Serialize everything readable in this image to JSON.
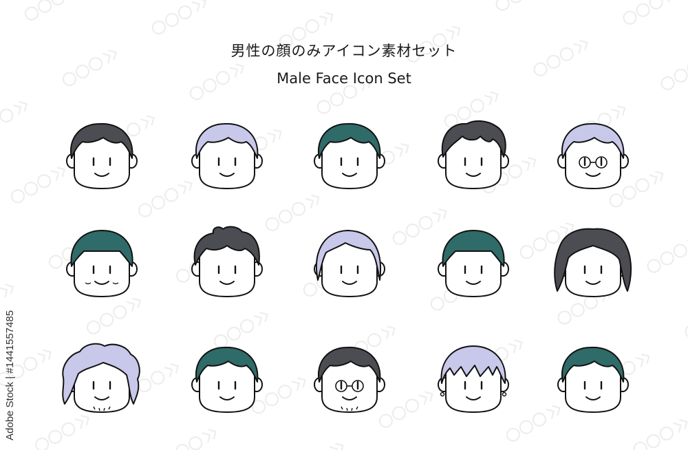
{
  "title_jp": "男性の顔のみアイコン素材セット",
  "title_en": "Male Face Icon Set",
  "watermark_side": "Adobe Stock | #1441557485",
  "colors": {
    "outline": "#111111",
    "dark_hair": "#4b4d52",
    "teal_hair": "#2f6b68",
    "lavender_hair": "#c8c8ea",
    "skin": "#ffffff"
  },
  "faces": [
    {
      "hair": "dark_hair",
      "style": "short",
      "glasses": false,
      "extra": "none"
    },
    {
      "hair": "lavender_hair",
      "style": "short",
      "glasses": false,
      "extra": "none"
    },
    {
      "hair": "teal_hair",
      "style": "short",
      "glasses": false,
      "extra": "none"
    },
    {
      "hair": "dark_hair",
      "style": "wavy",
      "glasses": false,
      "extra": "none"
    },
    {
      "hair": "lavender_hair",
      "style": "short",
      "glasses": true,
      "extra": "none"
    },
    {
      "hair": "teal_hair",
      "style": "bowl",
      "glasses": false,
      "extra": "wrinkles"
    },
    {
      "hair": "dark_hair",
      "style": "messy",
      "glasses": false,
      "extra": "none"
    },
    {
      "hair": "lavender_hair",
      "style": "side",
      "glasses": false,
      "extra": "none"
    },
    {
      "hair": "teal_hair",
      "style": "bowl",
      "glasses": false,
      "extra": "none"
    },
    {
      "hair": "dark_hair",
      "style": "long",
      "glasses": false,
      "extra": "none"
    },
    {
      "hair": "lavender_hair",
      "style": "curly",
      "glasses": false,
      "extra": "beard"
    },
    {
      "hair": "teal_hair",
      "style": "short",
      "glasses": false,
      "extra": "none"
    },
    {
      "hair": "dark_hair",
      "style": "short",
      "glasses": true,
      "extra": "beard"
    },
    {
      "hair": "lavender_hair",
      "style": "fringe",
      "glasses": false,
      "extra": "earrings"
    },
    {
      "hair": "teal_hair",
      "style": "short",
      "glasses": false,
      "extra": "none"
    }
  ]
}
